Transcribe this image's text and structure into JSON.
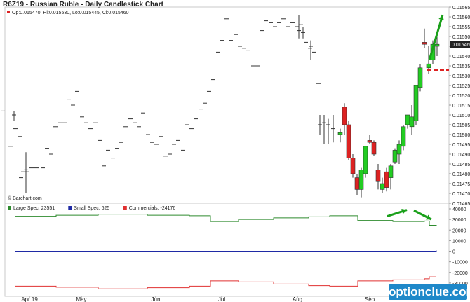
{
  "title": "R6Z19 - Russian Ruble - Daily Candlestick Chart",
  "ohlc_readout": "Op:0.015470, Hi:0.015530, Lo:0.015445, Cl:0.015460",
  "source_label": "© Barchart.com",
  "watermark": "optionclue.com",
  "colors": {
    "up": "#22cc22",
    "down": "#dd2222",
    "large_spec": "#2e8b2e",
    "small_spec": "#1f2aa5",
    "commercials": "#e03030",
    "arrow": "#1aa01a",
    "level": "#dd2222"
  },
  "x_axis_labels": [
    "Apr 19",
    "May",
    "Jun",
    "Jul",
    "Aug",
    "Sep"
  ],
  "chart_data": [
    {
      "type": "candlestick",
      "ylim": [
        0.01465,
        0.01565
      ],
      "y_ticks": [
        "0.015650",
        "0.015600",
        "0.015550",
        "0.015500",
        "0.015450",
        "0.015400",
        "0.015350",
        "0.015300",
        "0.015250",
        "0.015200",
        "0.015150",
        "0.015100",
        "0.015050",
        "0.015000",
        "0.014950",
        "0.014900",
        "0.014850",
        "0.014800",
        "0.014750",
        "0.014700",
        "0.014650"
      ],
      "last_price_label": "0.015460",
      "flat_ticks": [
        [
          4,
          0.01512
        ],
        [
          15,
          0.01494
        ],
        [
          22,
          0.01503
        ],
        [
          28,
          0.01499
        ],
        [
          30,
          0.01478
        ],
        [
          33,
          0.01481
        ],
        [
          38,
          0.01481
        ],
        [
          45,
          0.01483
        ],
        [
          52,
          0.01483
        ],
        [
          61,
          0.01483
        ],
        [
          67,
          0.01493
        ],
        [
          73,
          0.0149
        ],
        [
          79,
          0.01504
        ],
        [
          85,
          0.01506
        ],
        [
          92,
          0.01506
        ],
        [
          98,
          0.01518
        ],
        [
          104,
          0.01515
        ],
        [
          110,
          0.01522
        ],
        [
          117,
          0.01509
        ],
        [
          123,
          0.01506
        ],
        [
          129,
          0.01503
        ],
        [
          136,
          0.01506
        ],
        [
          142,
          0.01497
        ],
        [
          148,
          0.01484
        ],
        [
          154,
          0.01492
        ],
        [
          161,
          0.01488
        ],
        [
          167,
          0.01493
        ],
        [
          173,
          0.01496
        ],
        [
          179,
          0.01504
        ],
        [
          186,
          0.01508
        ],
        [
          192,
          0.01506
        ],
        [
          198,
          0.01504
        ],
        [
          204,
          0.01511
        ],
        [
          211,
          0.015
        ],
        [
          217,
          0.01496
        ],
        [
          223,
          0.01495
        ],
        [
          229,
          0.01499
        ],
        [
          236,
          0.01489
        ],
        [
          242,
          0.0149
        ],
        [
          248,
          0.01495
        ],
        [
          254,
          0.01497
        ],
        [
          261,
          0.01492
        ],
        [
          267,
          0.01505
        ],
        [
          273,
          0.01503
        ],
        [
          279,
          0.01508
        ],
        [
          286,
          0.01513
        ],
        [
          292,
          0.01516
        ],
        [
          298,
          0.01522
        ],
        [
          304,
          0.01528
        ],
        [
          311,
          0.01542
        ],
        [
          317,
          0.01548
        ],
        [
          323,
          0.01559
        ],
        [
          329,
          0.01548
        ],
        [
          336,
          0.01551
        ],
        [
          342,
          0.01545
        ],
        [
          348,
          0.01544
        ],
        [
          354,
          0.01543
        ],
        [
          361,
          0.01535
        ],
        [
          367,
          0.01535
        ],
        [
          373,
          0.01553
        ],
        [
          379,
          0.01558
        ],
        [
          386,
          0.01557
        ],
        [
          392,
          0.01555
        ],
        [
          398,
          0.01557
        ],
        [
          404,
          0.01559
        ],
        [
          411,
          0.01555
        ],
        [
          417,
          0.01557
        ],
        [
          423,
          0.01555
        ],
        [
          429,
          0.01556
        ],
        [
          436,
          0.01547
        ],
        [
          442,
          0.01544
        ],
        [
          448,
          0.01542
        ],
        [
          454,
          0.01526
        ]
      ],
      "wick_ticks": [
        [
          20,
          0.01512,
          0.01507,
          0.0151,
          0.0151
        ],
        [
          37,
          0.0147,
          0.01491,
          0.01482,
          0.01482
        ],
        [
          426,
          0.01549,
          0.01561,
          0.01553,
          0.01553
        ],
        [
          432,
          0.01549,
          0.01555,
          0.01552,
          0.01552
        ],
        [
          443,
          0.01538,
          0.01548,
          0.01545,
          0.01545
        ],
        [
          456,
          0.015,
          0.0151,
          0.01505,
          0.01505
        ],
        [
          462,
          0.01495,
          0.0151,
          0.01506,
          0.01506
        ],
        [
          468,
          0.01495,
          0.01508,
          0.01505,
          0.01505
        ],
        [
          475,
          0.01496,
          0.0151,
          0.01503,
          0.01503
        ]
      ],
      "candles": [
        [
          485,
          0.015,
          0.01503,
          0.01496,
          0.01501
        ],
        [
          491,
          0.01514,
          0.01516,
          0.015,
          0.01505
        ],
        [
          497,
          0.01505,
          0.01507,
          0.01487,
          0.01488
        ],
        [
          503,
          0.01488,
          0.0149,
          0.01478,
          0.0148
        ],
        [
          509,
          0.01478,
          0.0148,
          0.01469,
          0.01472
        ],
        [
          515,
          0.01472,
          0.01483,
          0.01468,
          0.01482
        ],
        [
          521,
          0.0148,
          0.01494,
          0.01478,
          0.01494
        ],
        [
          527,
          0.01497,
          0.015,
          0.01495,
          0.01496
        ],
        [
          533,
          0.01496,
          0.01497,
          0.01489,
          0.0149
        ],
        [
          539,
          0.01482,
          0.01485,
          0.01472,
          0.01476
        ],
        [
          545,
          0.01472,
          0.01478,
          0.0147,
          0.01475
        ],
        [
          551,
          0.01481,
          0.01483,
          0.01471,
          0.01473
        ],
        [
          557,
          0.01478,
          0.01485,
          0.01472,
          0.01484
        ],
        [
          563,
          0.01486,
          0.01493,
          0.01485,
          0.01492
        ],
        [
          569,
          0.0149,
          0.01497,
          0.01485,
          0.01495
        ],
        [
          575,
          0.01494,
          0.01505,
          0.01492,
          0.01504
        ],
        [
          581,
          0.01505,
          0.0151,
          0.01503,
          0.0151
        ],
        [
          587,
          0.01504,
          0.01515,
          0.015,
          0.01509
        ],
        [
          593,
          0.01507,
          0.01525,
          0.01505,
          0.01525
        ],
        [
          599,
          0.01524,
          0.01536,
          0.01522,
          0.01534
        ],
        [
          605,
          0.01547,
          0.01554,
          0.01544,
          0.01546
        ],
        [
          611,
          0.01534,
          0.01545,
          0.01531,
          0.01536
        ],
        [
          617,
          0.01538,
          0.01548,
          0.01536,
          0.01546
        ],
        [
          623,
          0.01545,
          0.01551,
          0.0154,
          0.01546
        ]
      ],
      "level_line": {
        "value": 0.01533,
        "from_x": 609
      },
      "trend_arrow": {
        "from": [
          612,
          0.01538
        ],
        "to": [
          631,
          0.01561
        ]
      }
    },
    {
      "type": "line",
      "ylim": [
        -40000,
        40000
      ],
      "y_ticks": [
        "40000",
        "30000",
        "20000",
        "10000",
        "0",
        "-10000",
        "-20000",
        "-30000",
        "-40000"
      ],
      "legend": [
        {
          "name": "Large Spec: 23551",
          "color": "#2e8b2e"
        },
        {
          "name": "Small Spec: 625",
          "color": "#1f2aa5"
        },
        {
          "name": "Commercials: -24176",
          "color": "#e03030"
        }
      ],
      "series": [
        {
          "color": "#2e8b2e",
          "steps": [
            [
              22,
              33000
            ],
            [
              80,
              34000
            ],
            [
              140,
              35000
            ],
            [
              210,
              34000
            ],
            [
              270,
              33500
            ],
            [
              300,
              28000
            ],
            [
              340,
              30000
            ],
            [
              390,
              31500
            ],
            [
              440,
              32500
            ],
            [
              470,
              33500
            ],
            [
              510,
              29000
            ],
            [
              560,
              28000
            ],
            [
              605,
              28500
            ],
            [
              612,
              24500
            ],
            [
              622,
              23551
            ]
          ]
        },
        {
          "color": "#1f2aa5",
          "steps": [
            [
              22,
              0
            ],
            [
              622,
              625
            ]
          ]
        },
        {
          "color": "#e03030",
          "steps": [
            [
              22,
              -33000
            ],
            [
              80,
              -34000
            ],
            [
              140,
              -35500
            ],
            [
              210,
              -34500
            ],
            [
              270,
              -33000
            ],
            [
              300,
              -28000
            ],
            [
              340,
              -29000
            ],
            [
              390,
              -31000
            ],
            [
              440,
              -32500
            ],
            [
              470,
              -33000
            ],
            [
              510,
              -28000
            ],
            [
              560,
              -27000
            ],
            [
              605,
              -26000
            ],
            [
              612,
              -24176
            ],
            [
              622,
              -24176
            ]
          ]
        }
      ],
      "arrows": [
        {
          "from": [
            552,
            33000
          ],
          "to": [
            580,
            39000
          ]
        },
        {
          "from": [
            590,
            38500
          ],
          "to": [
            615,
            30000
          ]
        }
      ]
    }
  ]
}
